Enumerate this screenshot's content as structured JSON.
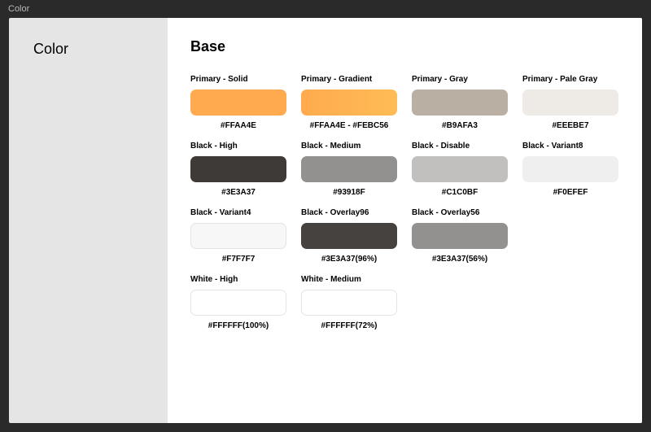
{
  "topbar": {
    "title": "Color"
  },
  "sidebar": {
    "title": "Color"
  },
  "main": {
    "section_title": "Base",
    "swatches": [
      {
        "label": "Primary - Solid",
        "code": "#FFAA4E",
        "style": "background:#FFAA4E"
      },
      {
        "label": "Primary - Gradient",
        "code": "#FFAA4E - #FEBC56",
        "style": "background:linear-gradient(90deg,#FFAA4E,#FEBC56)"
      },
      {
        "label": "Primary - Gray",
        "code": "#B9AFA3",
        "style": "background:#B9AFA3"
      },
      {
        "label": "Primary - Pale Gray",
        "code": "#EEEBE7",
        "style": "background:#EEEBE7"
      },
      {
        "label": "Black - High",
        "code": "#3E3A37",
        "style": "background:#3E3A37"
      },
      {
        "label": "Black - Medium",
        "code": "#93918F",
        "style": "background:#93918F"
      },
      {
        "label": "Black - Disable",
        "code": "#C1C0BF",
        "style": "background:#C1C0BF"
      },
      {
        "label": "Black - Variant8",
        "code": "#F0EFEF",
        "style": "background:#F0EFEF"
      },
      {
        "label": "Black - Variant4",
        "code": "#F7F7F7",
        "style": "background:#F7F7F7",
        "border": true
      },
      {
        "label": "Black - Overlay96",
        "code": "#3E3A37(96%)",
        "style": "background:rgba(62,58,55,0.96)"
      },
      {
        "label": "Black - Overlay56",
        "code": "#3E3A37(56%)",
        "style": "background:rgba(62,58,55,0.56)"
      },
      {
        "label": "",
        "code": "",
        "style": "visibility:hidden"
      },
      {
        "label": "White - High",
        "code": "#FFFFFF(100%)",
        "style": "background:#FFFFFF",
        "border": true
      },
      {
        "label": "White - Medium",
        "code": "#FFFFFF(72%)",
        "style": "background:rgba(255,255,255,0.72)",
        "border": true
      }
    ]
  }
}
